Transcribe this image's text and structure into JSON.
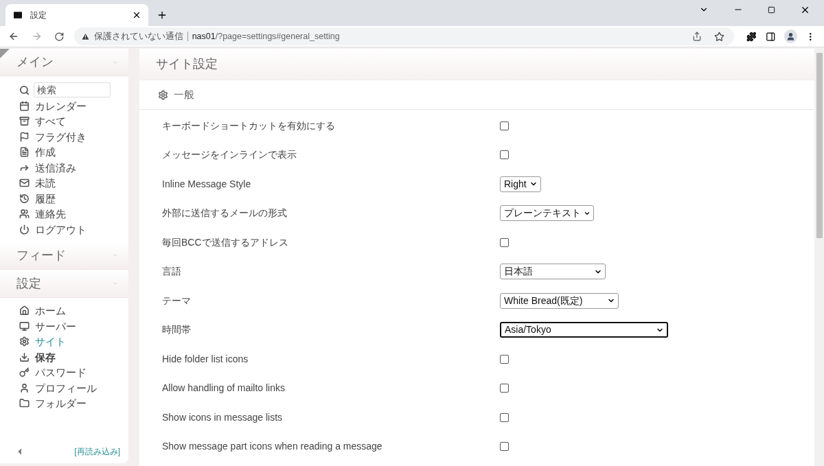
{
  "browser": {
    "tab_title": "設定",
    "security_label": "保護されていない通信",
    "url_host": "nas01",
    "url_path": "/?page=settings#general_setting"
  },
  "sidebar": {
    "sections": [
      {
        "title": "メイン",
        "search_placeholder": "検索",
        "items": [
          {
            "label": "カレンダー",
            "selected": false,
            "bold": false
          },
          {
            "label": "すべて",
            "selected": false,
            "bold": false
          },
          {
            "label": "フラグ付き",
            "selected": false,
            "bold": false
          },
          {
            "label": "作成",
            "selected": false,
            "bold": false
          },
          {
            "label": "送信済み",
            "selected": false,
            "bold": false
          },
          {
            "label": "未読",
            "selected": false,
            "bold": false
          },
          {
            "label": "履歴",
            "selected": false,
            "bold": false
          },
          {
            "label": "連絡先",
            "selected": false,
            "bold": false
          },
          {
            "label": "ログアウト",
            "selected": false,
            "bold": false
          }
        ]
      },
      {
        "title": "フィード"
      },
      {
        "title": "設定",
        "items": [
          {
            "label": "ホーム",
            "selected": false,
            "bold": false
          },
          {
            "label": "サーバー",
            "selected": false,
            "bold": false
          },
          {
            "label": "サイト",
            "selected": true,
            "bold": false
          },
          {
            "label": "保存",
            "selected": false,
            "bold": true
          },
          {
            "label": "パスワード",
            "selected": false,
            "bold": false
          },
          {
            "label": "プロフィール",
            "selected": false,
            "bold": false
          },
          {
            "label": "フォルダー",
            "selected": false,
            "bold": false
          }
        ]
      }
    ],
    "reload_link": "[再読み込み]"
  },
  "main": {
    "title": "サイト設定",
    "section": "一般",
    "rows": [
      {
        "label": "キーボードショートカットを有効にする",
        "kind": "checkbox",
        "checked": false
      },
      {
        "label": "メッセージをインラインで表示",
        "kind": "checkbox",
        "checked": false
      },
      {
        "label": "Inline Message Style",
        "kind": "select",
        "value": "Right",
        "focused": false
      },
      {
        "label": "外部に送信するメールの形式",
        "kind": "select",
        "value": "プレーンテキスト",
        "focused": false
      },
      {
        "label": "毎回BCCで送信するアドレス",
        "kind": "checkbox",
        "checked": false
      },
      {
        "label": "言語",
        "kind": "select",
        "value": "日本語",
        "focused": false
      },
      {
        "label": "テーマ",
        "kind": "select",
        "value": "White Bread(既定)",
        "focused": false
      },
      {
        "label": "時間帯",
        "kind": "select",
        "value": "Asia/Tokyo",
        "focused": true
      },
      {
        "label": "Hide folder list icons",
        "kind": "checkbox",
        "checked": false
      },
      {
        "label": "Allow handling of mailto links",
        "kind": "checkbox",
        "checked": false
      },
      {
        "label": "Show icons in message lists",
        "kind": "checkbox",
        "checked": false
      },
      {
        "label": "Show message part icons when reading a message",
        "kind": "checkbox",
        "checked": false
      }
    ]
  }
}
